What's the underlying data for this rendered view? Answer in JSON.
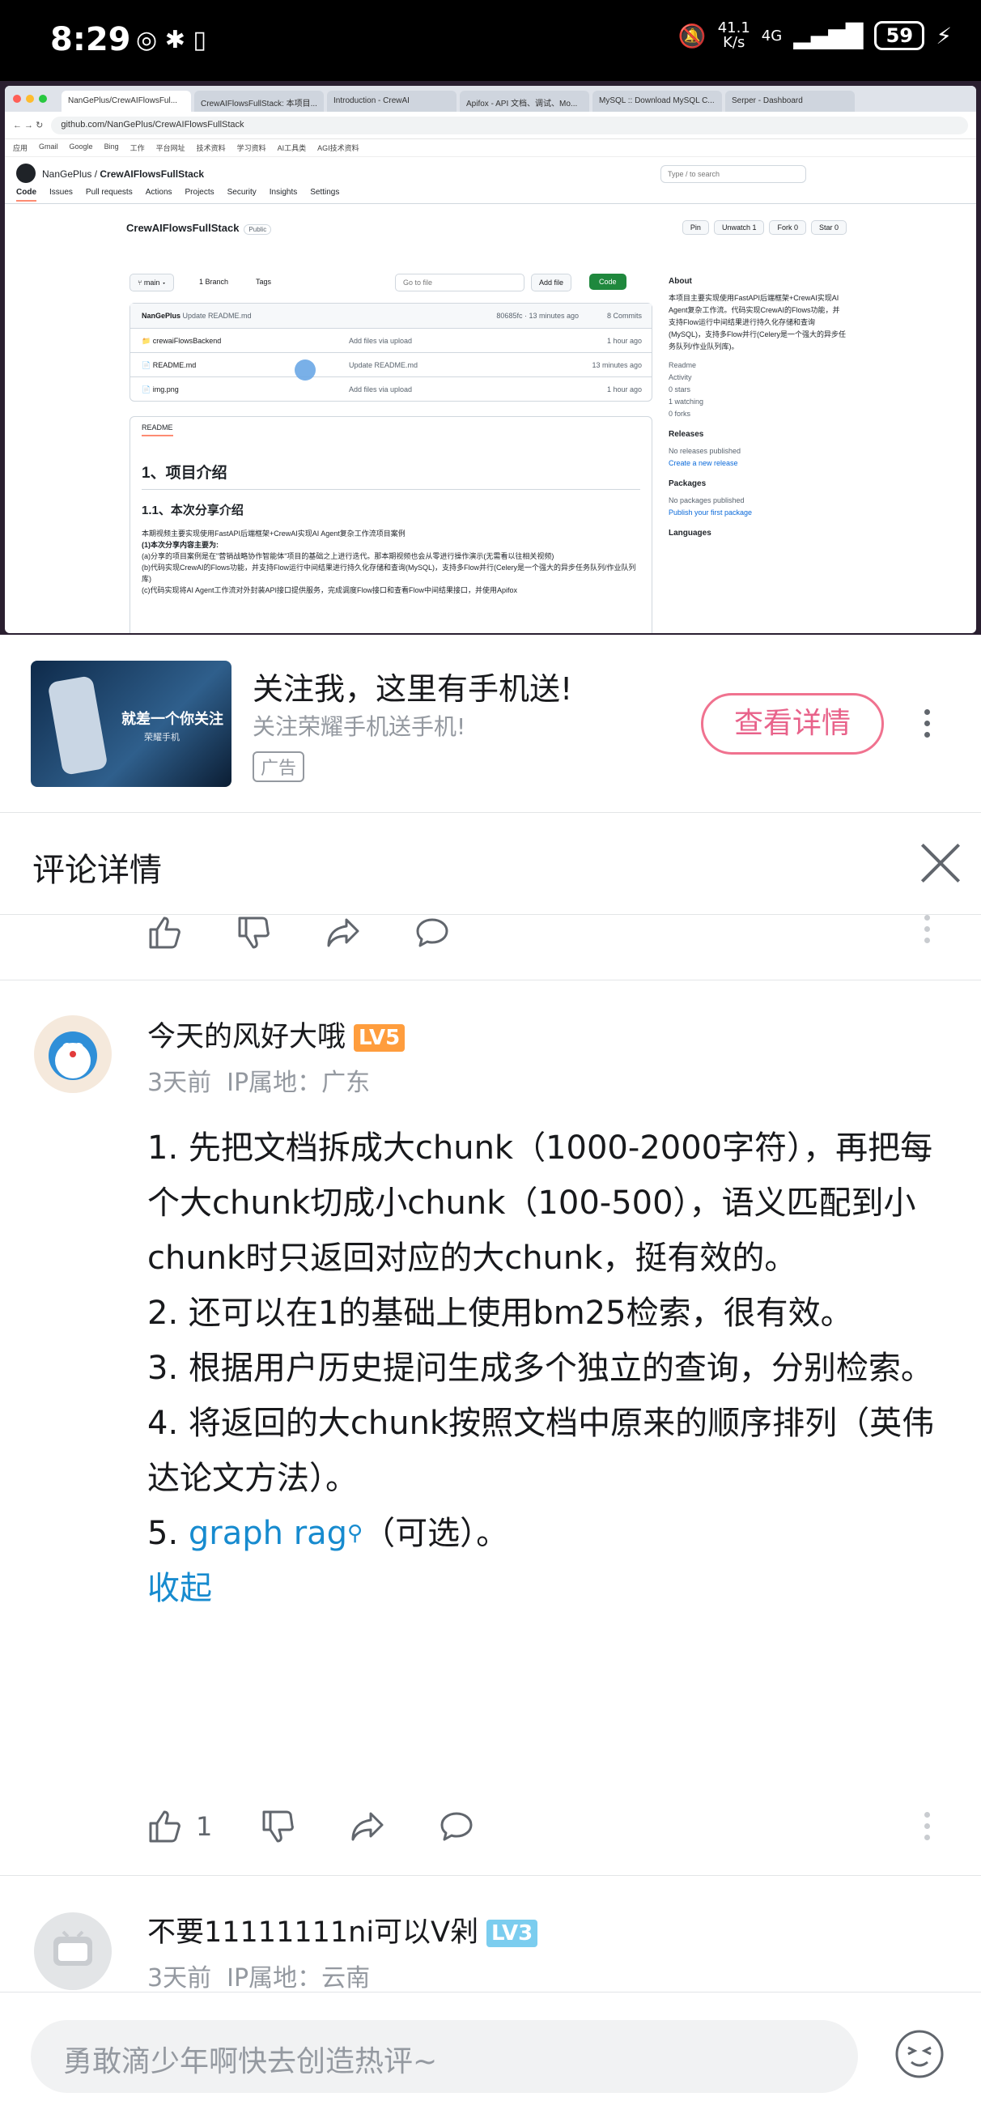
{
  "status_bar": {
    "time": "8:29",
    "net_speed_value": "41.1",
    "net_speed_unit": "K/s",
    "network": "4G",
    "battery": "59"
  },
  "video": {
    "tabs": [
      "NanGePlus/CrewAIFlowsFul...",
      "CrewAIFlowsFullStack: 本项目...",
      "Introduction - CrewAI",
      "Apifox - API 文档、调试、Mo...",
      "MySQL :: Download MySQL C...",
      "Serper - Dashboard"
    ],
    "url": "github.com/NanGePlus/CrewAIFlowsFullStack",
    "bookmarks": [
      "应用",
      "Gmail",
      "Google",
      "Bing",
      "工作",
      "平台网址",
      "技术资料",
      "学习资料",
      "AI工具类",
      "AGI技术资料"
    ],
    "owner": "NanGePlus",
    "repo": "CrewAIFlowsFullStack",
    "search_placeholder": "Type / to search",
    "nav": [
      "Code",
      "Issues",
      "Pull requests",
      "Actions",
      "Projects",
      "Security",
      "Insights",
      "Settings"
    ],
    "public_badge": "Public",
    "repo_buttons": [
      "Pin",
      "Unwatch 1",
      "Fork 0",
      "Star 0"
    ],
    "branch": "main",
    "branch_count": "1 Branch",
    "tags": "Tags",
    "go_to_file": "Go to file",
    "add_file": "Add file",
    "code_btn": "Code",
    "latest_commit": {
      "author": "NanGePlus",
      "message": "Update README.md",
      "meta": "80685fc · 13 minutes ago",
      "commits": "8 Commits"
    },
    "files": [
      {
        "name": "crewaiFlowsBackend",
        "message": "Add files via upload",
        "when": "1 hour ago"
      },
      {
        "name": "README.md",
        "message": "Update README.md",
        "when": "13 minutes ago"
      },
      {
        "name": "img.png",
        "message": "Add files via upload",
        "when": "1 hour ago"
      }
    ],
    "readme_label": "README",
    "readme_h1": "1、项目介绍",
    "readme_h2": "1.1、本次分享介绍",
    "readme_lines": [
      "本期视频主要实现使用FastAPI后端框架+CrewAI实现AI Agent复杂工作流项目案例",
      "(1)本次分享内容主要为:",
      "(a)分享的项目案例是在\"营销战略协作智能体\"项目的基础之上进行迭代。那本期视频也会从零进行操作演示(无需看以往相关视频)",
      "(b)代码实现CrewAI的Flows功能，并支持Flow运行中间结果进行持久化存储和查询(MySQL)，支持多Flow并行(Celery是一个强大的异步任务队列/作业队列库)",
      "(c)代码实现将AI Agent工作流对外封装API接口提供服务，完成调度Flow接口和查看Flow中间结果接口，并使用Apifox"
    ],
    "about_title": "About",
    "about_text": "本项目主要实现使用FastAPI后端框架+CrewAI实现AI Agent复杂工作流。代码实现CrewAI的Flows功能，并支持Flow运行中间结果进行持久化存储和查询(MySQL)，支持多Flow并行(Celery是一个强大的异步任务队列/作业队列库)。",
    "about_items": [
      "Readme",
      "Activity",
      "0 stars",
      "1 watching",
      "0 forks"
    ],
    "releases_title": "Releases",
    "releases_text": "No releases published",
    "releases_link": "Create a new release",
    "packages_title": "Packages",
    "packages_text": "No packages published",
    "packages_link": "Publish your first package",
    "languages_title": "Languages"
  },
  "ad": {
    "image_text": "就差一个你关注",
    "image_sub": "荣耀手机",
    "title": "关注我，这里有手机送!",
    "subtitle": "关注荣耀手机送手机!",
    "tag": "广告",
    "button": "查看详情"
  },
  "comment_header": {
    "title": "评论详情"
  },
  "comments": [
    {
      "username": "今天的风好大哦",
      "level": "LV5",
      "level_color": "#ff9d3d",
      "time": "3天前",
      "location": "IP属地：广东",
      "lines": [
        "1. 先把文档拆成大chunk（1000-2000字符），再把每个大chunk切成小chunk（100-500），语义匹配到小chunk时只返回对应的大chunk，挺有效的。",
        "2. 还可以在1的基础上使用bm25检索，很有效。",
        "3. 根据用户历史提问生成多个独立的查询，分别检索。",
        "4. 将返回的大chunk按照文档中原来的顺序排列（英伟达论文方法）。"
      ],
      "line5_prefix": "5. ",
      "line5_link": "graph rag",
      "line5_suffix": "（可选）。",
      "fold": "收起",
      "likes": "1"
    },
    {
      "username": "不要11111111ni可以V剁",
      "level": "LV3",
      "level_color": "#7bcdef",
      "time": "3天前",
      "location": "IP属地：云南"
    }
  ],
  "input": {
    "placeholder": "勇敢滴少年啊快去创造热评~"
  }
}
